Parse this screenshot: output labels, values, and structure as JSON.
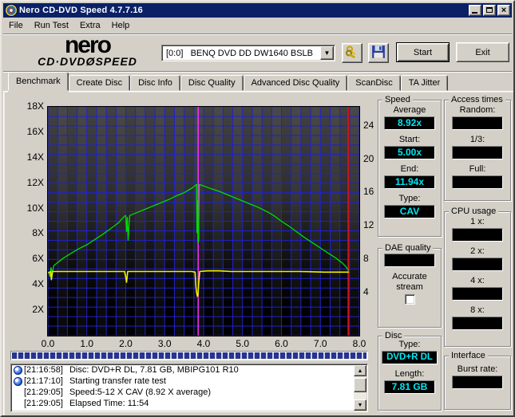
{
  "window": {
    "title": "Nero CD-DVD Speed 4.7.7.16"
  },
  "menu": {
    "items": [
      "File",
      "Run Test",
      "Extra",
      "Help"
    ]
  },
  "header": {
    "logo": {
      "line1": "nero",
      "line2a": "CD·DVD",
      "disc_char": "Ø",
      "line2b": "SPEED"
    },
    "drive_combo_value": "[0:0]   BENQ DVD DD DW1640 BSLB",
    "start_label": "Start",
    "exit_label": "Exit"
  },
  "tabs": [
    {
      "label": "Benchmark",
      "active": true
    },
    {
      "label": "Create Disc",
      "active": false
    },
    {
      "label": "Disc Info",
      "active": false
    },
    {
      "label": "Disc Quality",
      "active": false
    },
    {
      "label": "Advanced Disc Quality",
      "active": false
    },
    {
      "label": "ScanDisc",
      "active": false
    },
    {
      "label": "TA Jitter",
      "active": false
    }
  ],
  "chart_data": {
    "type": "line",
    "x_axis": {
      "range": [
        0,
        8
      ],
      "ticks": [
        "0.0",
        "1.0",
        "2.0",
        "3.0",
        "4.0",
        "5.0",
        "6.0",
        "7.0",
        "8.0"
      ]
    },
    "y_left_axis": {
      "range": [
        0,
        18
      ],
      "ticks": [
        "18X",
        "16X",
        "14X",
        "12X",
        "10X",
        "8X",
        "6X",
        "4X",
        "2X"
      ]
    },
    "y_right_axis": {
      "ticks": [
        24,
        20,
        16,
        12,
        8,
        4
      ]
    },
    "grid": {
      "color": "#2121cd",
      "x_divisions": 32,
      "y_divisions": 24
    },
    "plot_bg": "gradient dark gray to black",
    "markers": [
      {
        "type": "vline",
        "name": "layer-break",
        "x": 3.86,
        "color": "#ff2dff",
        "width": 1.5
      },
      {
        "type": "vline",
        "name": "end-of-disc",
        "x": 7.72,
        "color": "#d21414",
        "width": 2
      }
    ],
    "series": [
      {
        "name": "read-speed",
        "color": "#00dc00",
        "stroke_width": 1.3,
        "points": [
          [
            0.02,
            5.0
          ],
          [
            0.05,
            4.65
          ],
          [
            0.08,
            5.35
          ],
          [
            0.11,
            4.9
          ],
          [
            0.15,
            5.5
          ],
          [
            0.25,
            5.75
          ],
          [
            0.4,
            6.1
          ],
          [
            0.6,
            6.5
          ],
          [
            0.8,
            6.85
          ],
          [
            1.0,
            7.15
          ],
          [
            1.2,
            7.55
          ],
          [
            1.4,
            7.95
          ],
          [
            1.6,
            8.4
          ],
          [
            1.8,
            8.85
          ],
          [
            1.97,
            9.4
          ],
          [
            2.0,
            9.45
          ],
          [
            2.02,
            8.2
          ],
          [
            2.04,
            9.3
          ],
          [
            2.06,
            7.5
          ],
          [
            2.1,
            9.45
          ],
          [
            2.3,
            9.7
          ],
          [
            2.5,
            9.95
          ],
          [
            2.7,
            10.2
          ],
          [
            2.9,
            10.45
          ],
          [
            3.1,
            10.7
          ],
          [
            3.3,
            11.0
          ],
          [
            3.5,
            11.25
          ],
          [
            3.7,
            11.6
          ],
          [
            3.8,
            11.85
          ],
          [
            3.82,
            11.9
          ],
          [
            3.83,
            8.1
          ],
          [
            3.845,
            10.6
          ],
          [
            3.855,
            7.3
          ],
          [
            3.87,
            7.5
          ],
          [
            3.89,
            11.9
          ],
          [
            4.0,
            11.78
          ],
          [
            4.2,
            11.55
          ],
          [
            4.4,
            11.35
          ],
          [
            4.6,
            11.1
          ],
          [
            4.8,
            10.85
          ],
          [
            5.0,
            10.6
          ],
          [
            5.2,
            10.35
          ],
          [
            5.4,
            10.1
          ],
          [
            5.6,
            9.8
          ],
          [
            5.8,
            9.45
          ],
          [
            6.0,
            9.0
          ],
          [
            6.2,
            8.6
          ],
          [
            6.4,
            8.15
          ],
          [
            6.6,
            7.7
          ],
          [
            6.8,
            7.3
          ],
          [
            7.0,
            6.9
          ],
          [
            7.2,
            6.5
          ],
          [
            7.4,
            6.1
          ],
          [
            7.55,
            5.75
          ],
          [
            7.65,
            5.45
          ],
          [
            7.72,
            5.15
          ]
        ]
      },
      {
        "name": "rotation-speed",
        "color": "#f0f000",
        "stroke_width": 1.6,
        "points": [
          [
            0.02,
            4.95
          ],
          [
            0.07,
            5.05
          ],
          [
            0.09,
            4.4
          ],
          [
            0.12,
            5.05
          ],
          [
            0.55,
            5.05
          ],
          [
            1.0,
            5.05
          ],
          [
            1.5,
            5.05
          ],
          [
            1.97,
            5.05
          ],
          [
            2.0,
            4.6
          ],
          [
            2.02,
            4.2
          ],
          [
            2.05,
            5.05
          ],
          [
            2.5,
            5.05
          ],
          [
            3.0,
            5.05
          ],
          [
            3.7,
            5.05
          ],
          [
            3.78,
            5.0
          ],
          [
            3.8,
            3.9
          ],
          [
            3.82,
            3.4
          ],
          [
            3.84,
            3.1
          ],
          [
            3.855,
            3.15
          ],
          [
            3.87,
            4.0
          ],
          [
            3.9,
            5.05
          ],
          [
            4.1,
            5.1
          ],
          [
            4.4,
            5.1
          ],
          [
            4.7,
            5.05
          ],
          [
            5.5,
            5.05
          ],
          [
            6.5,
            5.05
          ],
          [
            7.1,
            5.0
          ],
          [
            7.72,
            5.0
          ]
        ]
      }
    ]
  },
  "panels": {
    "speed": {
      "title": "Speed",
      "fields": [
        {
          "label": "Average",
          "value": "8.92x"
        },
        {
          "label": "Start:",
          "value": "5.00x"
        },
        {
          "label": "End:",
          "value": "11.94x"
        },
        {
          "label": "Type:",
          "value": "CAV"
        }
      ]
    },
    "access": {
      "title": "Access times",
      "fields": [
        {
          "label": "Random:",
          "value": ""
        },
        {
          "label": "1/3:",
          "value": ""
        },
        {
          "label": "Full:",
          "value": ""
        }
      ]
    },
    "cpu": {
      "title": "CPU usage",
      "fields": [
        {
          "label": "1 x:",
          "value": ""
        },
        {
          "label": "2 x:",
          "value": ""
        },
        {
          "label": "4 x:",
          "value": ""
        },
        {
          "label": "8 x:",
          "value": ""
        }
      ]
    },
    "dae": {
      "title": "DAE quality",
      "value": "",
      "checkbox_label_1": "Accurate",
      "checkbox_label_2": "stream",
      "checked": false
    },
    "disc": {
      "title": "Disc",
      "fields": [
        {
          "label": "Type:",
          "value": "DVD+R DL"
        },
        {
          "label": "Length:",
          "value": "7.81 GB"
        }
      ]
    },
    "interface": {
      "title": "Interface",
      "fields": [
        {
          "label": "Burst rate:",
          "value": ""
        }
      ]
    }
  },
  "log": {
    "entries": [
      {
        "time": "[21:16:58]",
        "text": "Disc: DVD+R DL, 7.81 GB, MBIPG101 R10",
        "icon": true
      },
      {
        "time": "[21:17:10]",
        "text": "Starting transfer rate test",
        "icon": true
      },
      {
        "time": "[21:29:05]",
        "text": "Speed:5-12 X CAV (8.92 X average)",
        "icon": false
      },
      {
        "time": "[21:29:05]",
        "text": "Elapsed Time: 11:54",
        "icon": false
      }
    ]
  }
}
